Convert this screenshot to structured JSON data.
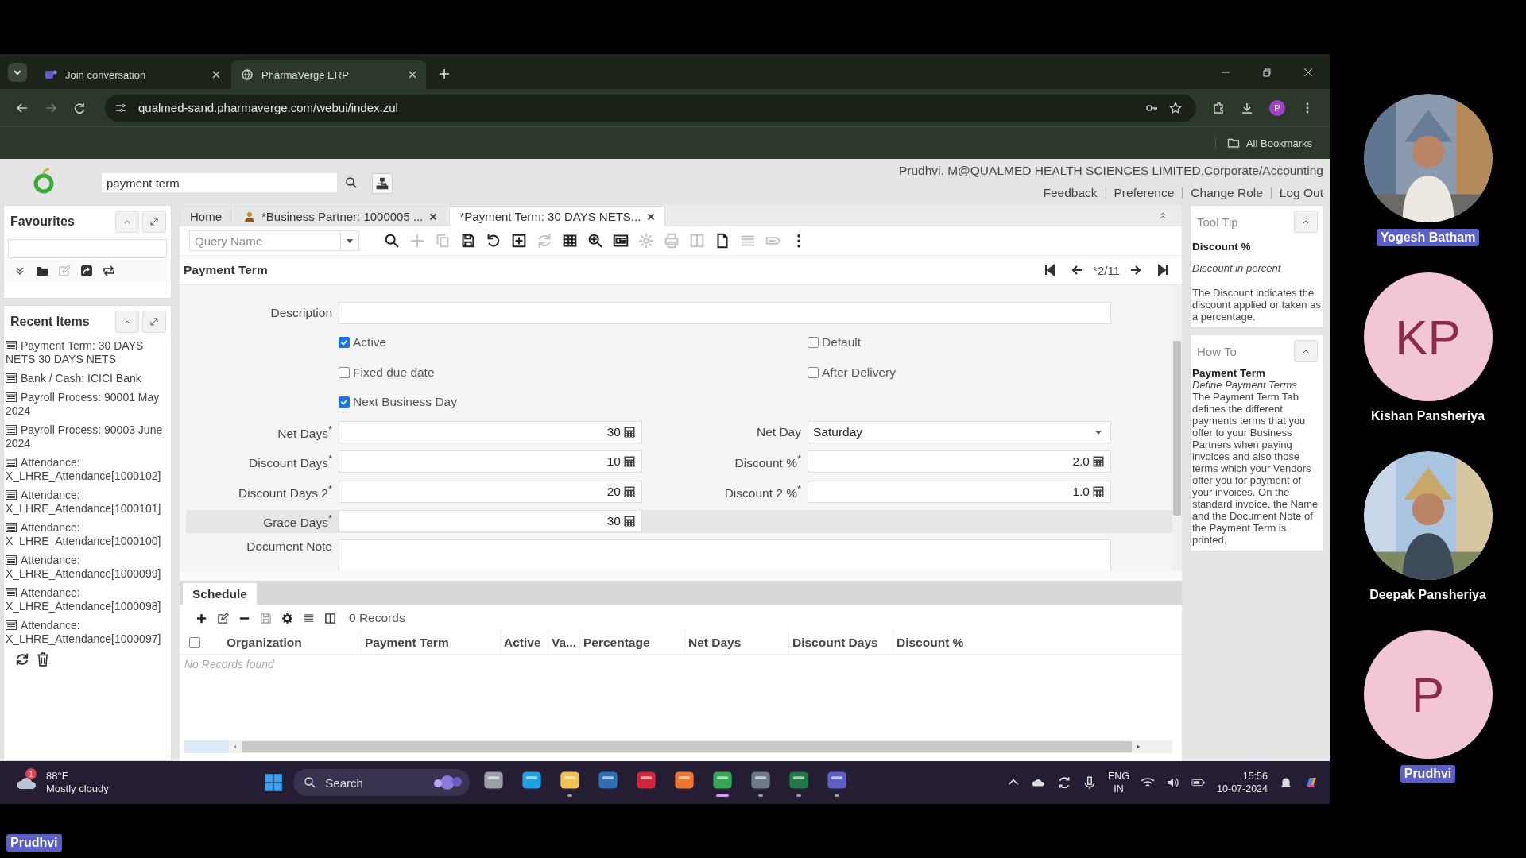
{
  "browser": {
    "tabs": [
      {
        "title": "Join conversation",
        "selected": false
      },
      {
        "title": "PharmaVerge ERP",
        "selected": true
      }
    ],
    "url": "qualmed-sand.pharmaverge.com/webui/index.zul",
    "profile": "P",
    "bookmarks": "All Bookmarks"
  },
  "header": {
    "search": {
      "value": "payment term"
    },
    "user": "Prudhvi. M@QUALMED HEALTH SCIENCES LIMITED.Corporate/Accounting",
    "links": [
      "Feedback",
      "Preference",
      "Change Role",
      "Log Out"
    ]
  },
  "favourites": {
    "title": "Favourites"
  },
  "recent_items": {
    "title": "Recent Items",
    "items": [
      "Payment Term: 30 DAYS NETS 30 DAYS NETS",
      "Bank / Cash: ICICI Bank",
      "Payroll Process: 90001 May 2024",
      "Payroll Process: 90003 June 2024",
      "Attendance: X_LHRE_Attendance[1000102]",
      "Attendance: X_LHRE_Attendance[1000101]",
      "Attendance: X_LHRE_Attendance[1000100]",
      "Attendance: X_LHRE_Attendance[1000099]",
      "Attendance: X_LHRE_Attendance[1000098]",
      "Attendance: X_LHRE_Attendance[1000097]"
    ]
  },
  "tabs": [
    {
      "label": "Home",
      "selected": false,
      "kind": "plain"
    },
    {
      "label": "*Business Partner: 1000005 ...",
      "selected": false,
      "kind": "partner"
    },
    {
      "label": "*Payment Term: 30 DAYS NETS...",
      "selected": true,
      "kind": "window"
    }
  ],
  "toolbar": {
    "query": {
      "placeholder": "Query Name"
    },
    "buttons": [
      {
        "disabled": false
      },
      {
        "disabled": true
      },
      {
        "disabled": true
      },
      {
        "disabled": false
      },
      {
        "disabled": false
      },
      {
        "disabled": false
      },
      {
        "disabled": true
      },
      {
        "disabled": false
      },
      {
        "disabled": false
      },
      {
        "disabled": false
      },
      {
        "disabled": true
      },
      {
        "disabled": true
      },
      {
        "disabled": true
      },
      {
        "disabled": false
      },
      {
        "disabled": true
      },
      {
        "disabled": true
      },
      {
        "disabled": false
      }
    ]
  },
  "record": {
    "title": "Payment Term",
    "position": "*2/11"
  },
  "form": {
    "description": {
      "label": "Description"
    },
    "checkbox_rows": [
      [
        {
          "label": "Active",
          "checked": true
        },
        {
          "label": "Default",
          "checked": false
        }
      ],
      [
        {
          "label": "Fixed due date",
          "checked": false
        },
        {
          "label": "After Delivery",
          "checked": false
        }
      ],
      [
        {
          "label": "Next Business Day",
          "checked": true
        }
      ]
    ],
    "field_rows": [
      {
        "highlighted": false,
        "fields": [
          {
            "label": "Net Days$^{*}$",
            "value": "30",
            "kind": "number"
          },
          {
            "label": "Net Day",
            "value": "Saturday",
            "kind": "select"
          }
        ]
      },
      {
        "highlighted": false,
        "fields": [
          {
            "label": "Discount Days$^{*}$",
            "value": "10",
            "kind": "number"
          },
          {
            "label": "Discount %$^{*}$",
            "value": "2.0",
            "kind": "number"
          }
        ]
      },
      {
        "highlighted": false,
        "fields": [
          {
            "label": "Discount Days 2$^{*}$",
            "value": "20",
            "kind": "number"
          },
          {
            "label": "Discount 2 %$^{*}$",
            "value": "1.0",
            "kind": "number"
          }
        ]
      },
      {
        "highlighted": true,
        "fields": [
          {
            "label": "Grace Days$^{*}$",
            "value": "30",
            "kind": "number"
          }
        ]
      }
    ],
    "document_note": {
      "label": "Document Note"
    }
  },
  "schedule": {
    "select_all_checked": false,
    "tab": "Schedule",
    "records": "0 Records",
    "columns": [
      "Organization",
      "Payment Term",
      "Active",
      "Va...",
      "Percentage",
      "Net Days",
      "Discount Days",
      "Discount %"
    ],
    "empty": "No Records found"
  },
  "tooltip": {
    "title": "Tool Tip",
    "heading": "Discount %",
    "subheading": "Discount in percent",
    "text": "The Discount indicates the discount applied or taken as a percentage."
  },
  "howto": {
    "title": "How To",
    "heading": "Payment Term",
    "subheading": "Define Payment Terms",
    "text": "The Payment Term Tab defines the different payments terms that you offer to your Business Partners when paying invoices and also those terms which your Vendors offer you for payment of your invoices. On the standard invoice, the Name and the Document Note of the Payment Term is printed."
  },
  "taskbar": {
    "weather": {
      "badge": "1",
      "temperature": "88°F",
      "condition": "Mostly cloudy"
    },
    "search": "Search",
    "apps": [
      {
        "running": false
      },
      {
        "running": false
      },
      {
        "running": true
      },
      {
        "running": false
      },
      {
        "running": false
      },
      {
        "running": false
      },
      {
        "running": true
      },
      {
        "running": true
      },
      {
        "running": true
      },
      {
        "running": true
      }
    ],
    "language": "ENG",
    "region": "IN",
    "time": "15:56",
    "date": "10-07-2024"
  },
  "participants": [
    {
      "name": "Yogesh Batham",
      "highlighted": true
    },
    {
      "name": "Kishan Pansheriya",
      "kind": "initials",
      "initials": "KP",
      "highlighted": false
    },
    {
      "name": "Deepak Pansheriya",
      "highlighted": false
    },
    {
      "name": "Prudhvi",
      "kind": "initials",
      "initials": "P",
      "highlighted": true
    }
  ],
  "self_label": "Prudhvi"
}
